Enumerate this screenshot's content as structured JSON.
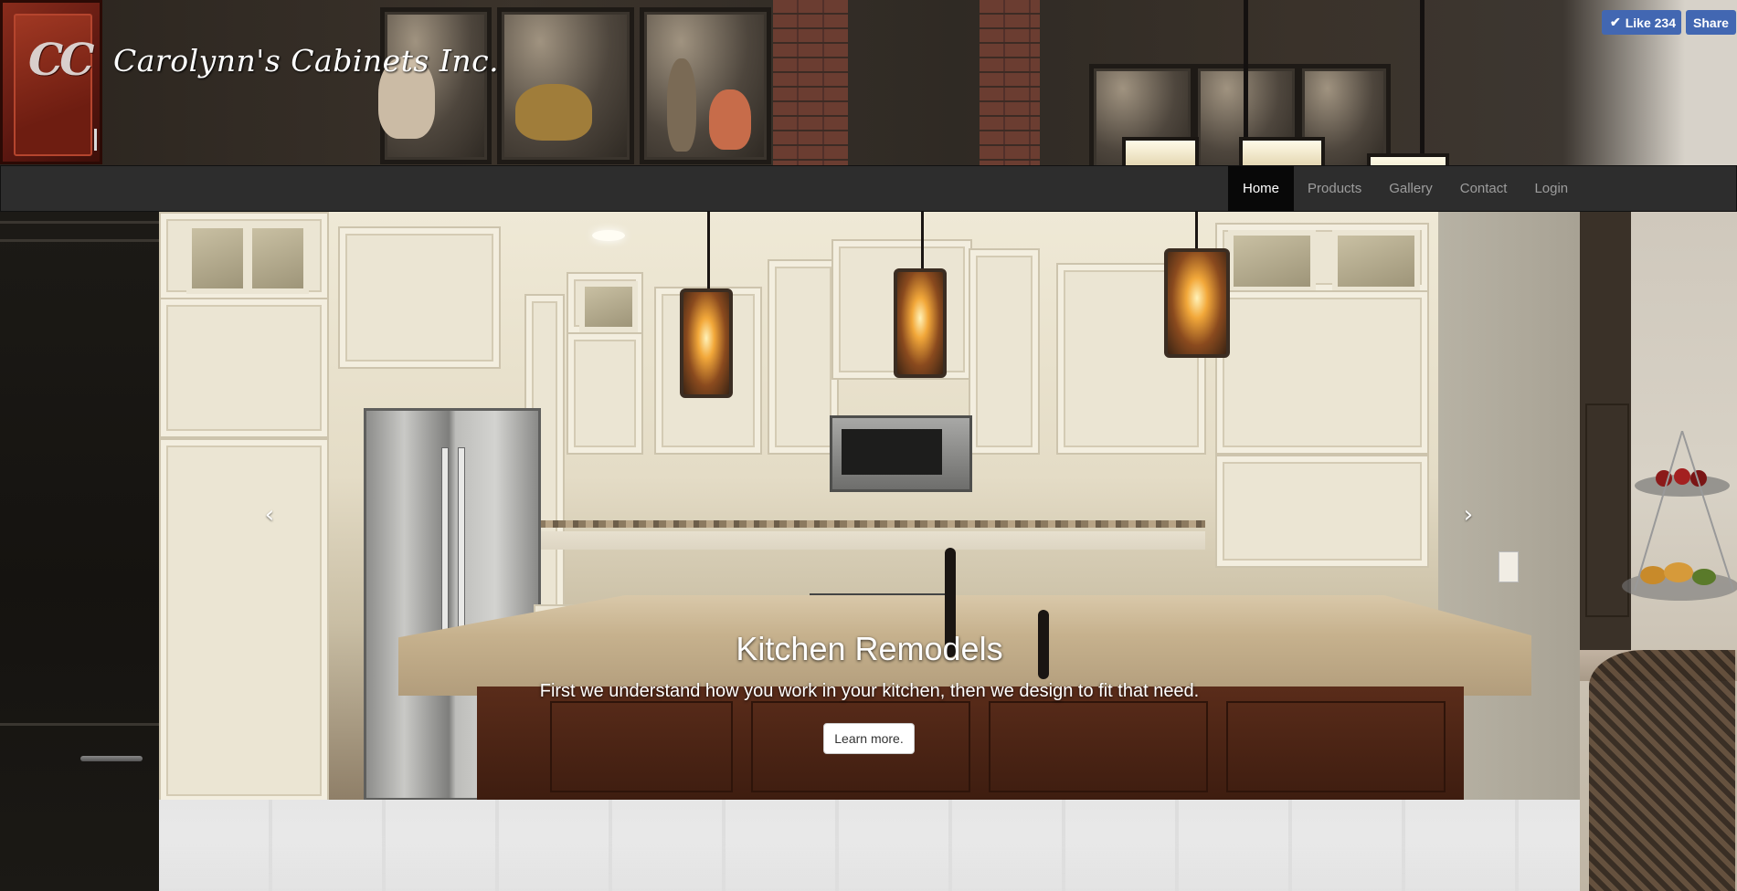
{
  "header": {
    "logo_monogram": "CC",
    "site_title": "Carolynn's Cabinets Inc.",
    "facebook": {
      "like_label": "Like 234",
      "share_label": "Share",
      "color": "#4267b2"
    }
  },
  "nav": {
    "items": [
      {
        "label": "Home",
        "active": true
      },
      {
        "label": "Products",
        "active": false
      },
      {
        "label": "Gallery",
        "active": false
      },
      {
        "label": "Contact",
        "active": false
      },
      {
        "label": "Login",
        "active": false
      }
    ]
  },
  "carousel": {
    "slide": {
      "title": "Kitchen Remodels",
      "text": "First we understand how you work in your kitchen, then we design to fit that need.",
      "button_label": "Learn more."
    },
    "prev_icon": "‹",
    "next_icon": "›"
  },
  "colors": {
    "navbar_bg": "#2d2d2d",
    "nav_active_bg": "#080808",
    "nav_text": "#9d9d9d"
  }
}
